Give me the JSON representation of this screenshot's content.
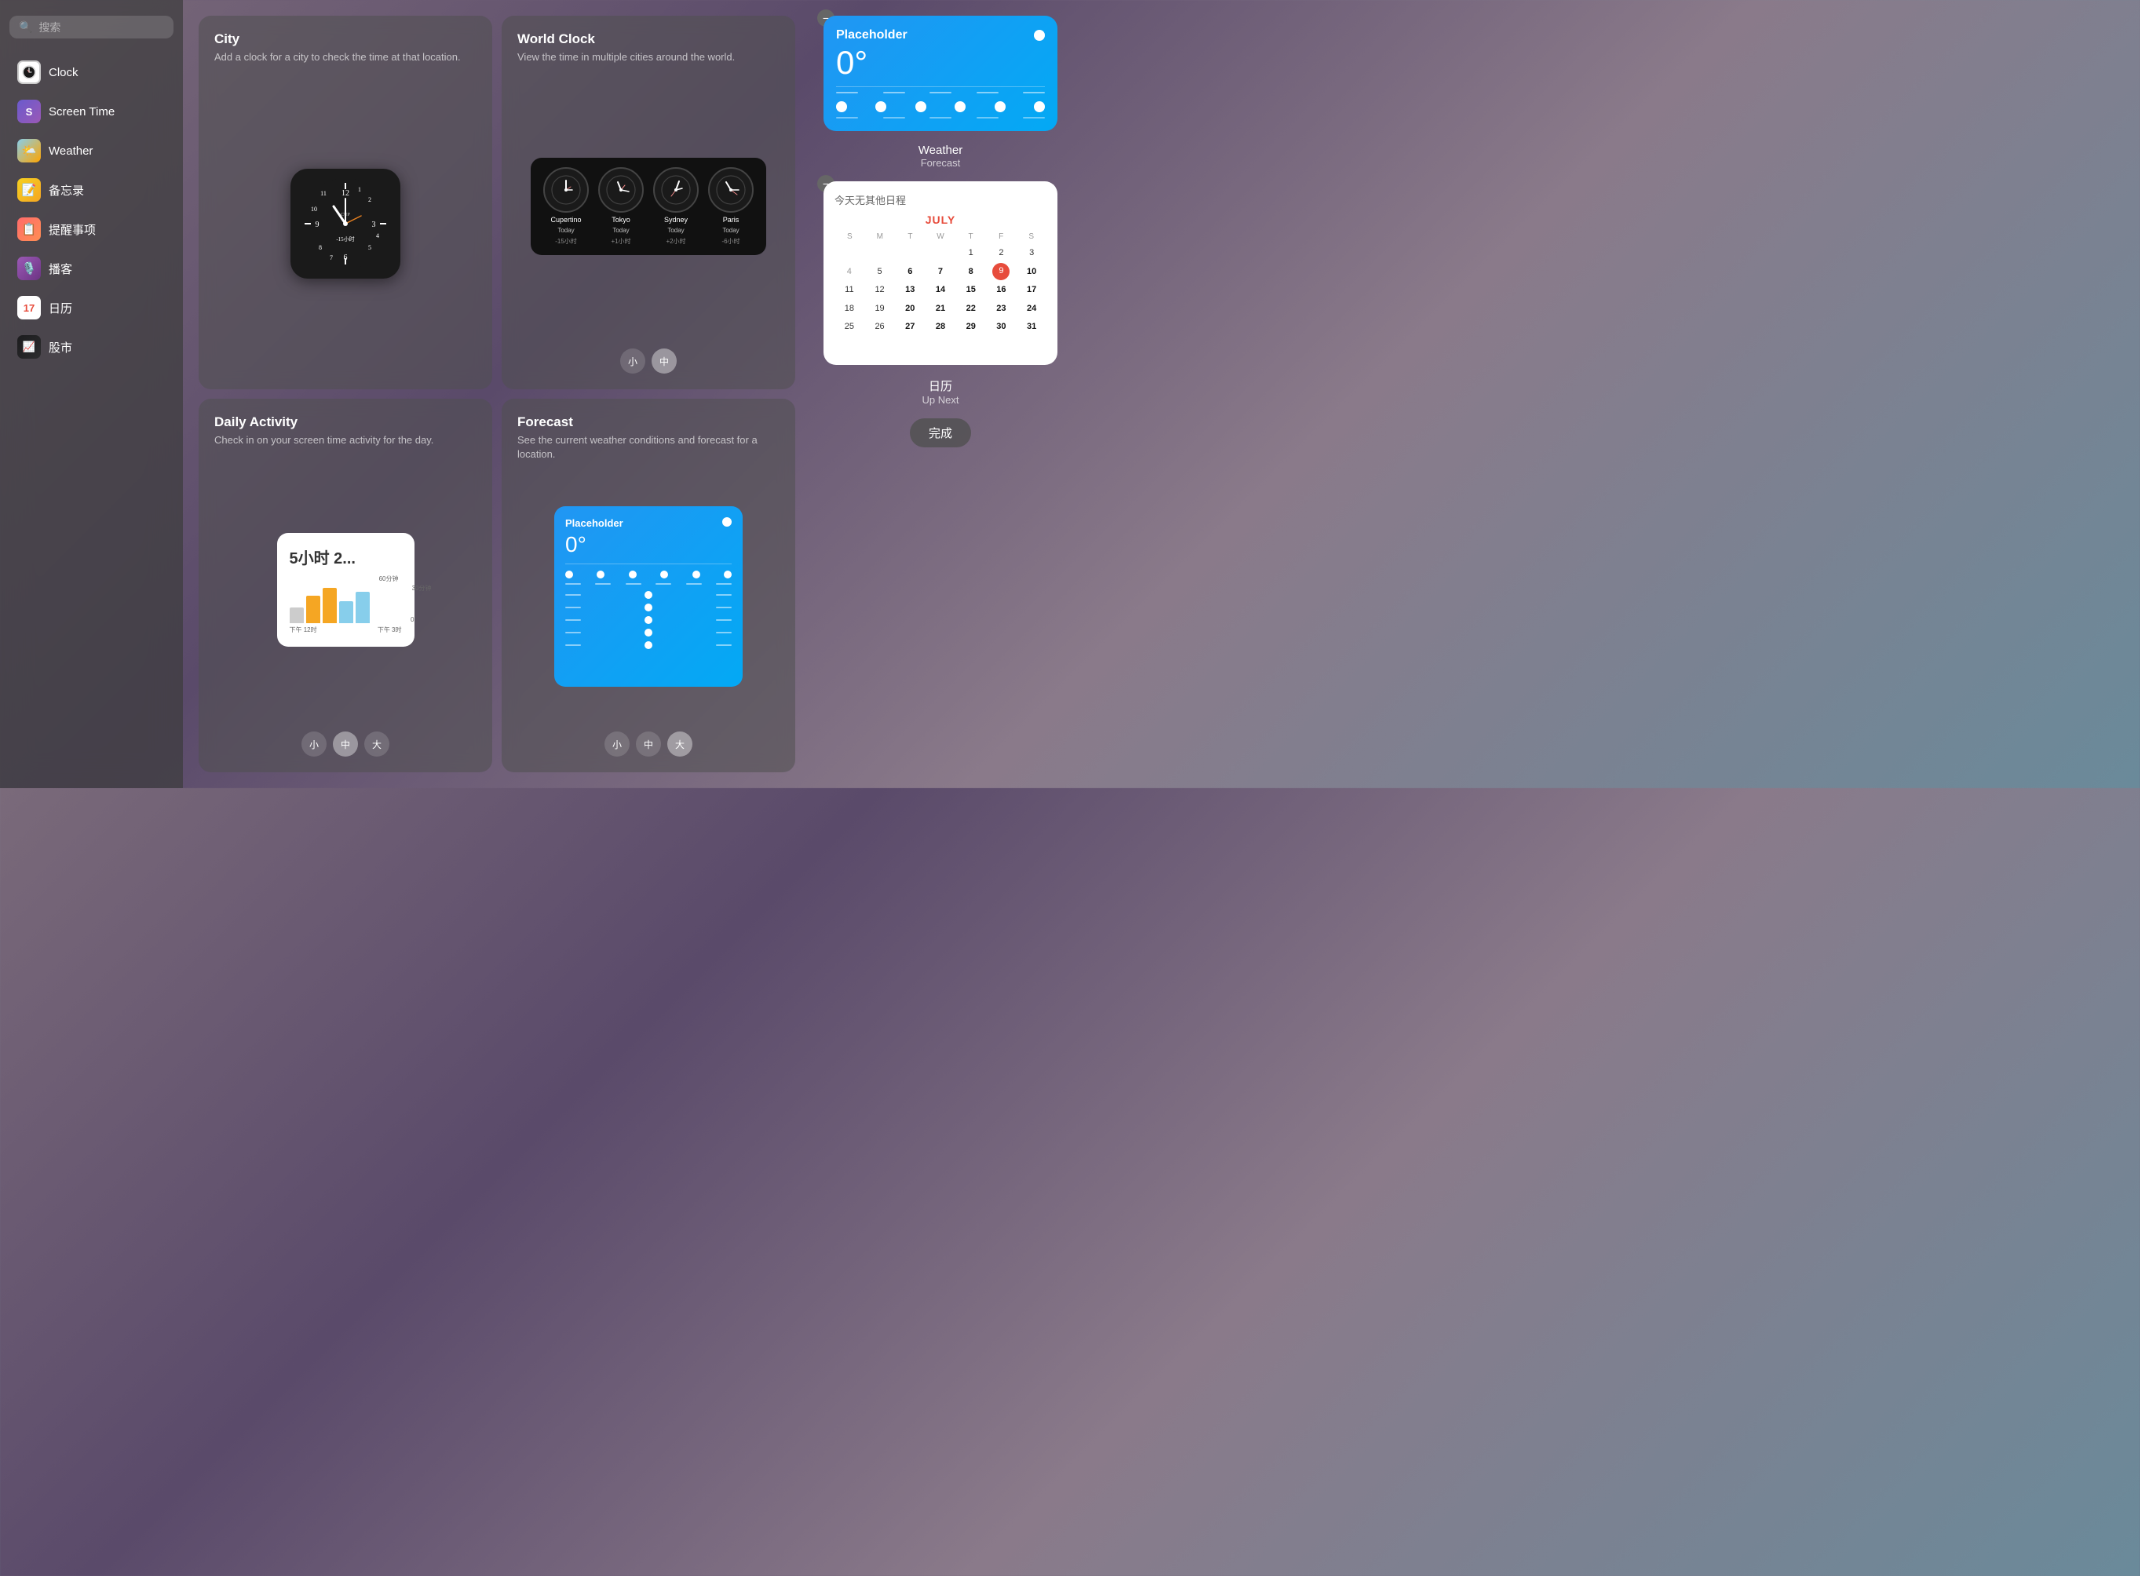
{
  "sidebar": {
    "search_placeholder": "搜索",
    "items": [
      {
        "id": "clock",
        "label": "Clock",
        "icon": "🕐",
        "icon_type": "clock"
      },
      {
        "id": "screentime",
        "label": "Screen Time",
        "icon": "S",
        "icon_type": "screentime"
      },
      {
        "id": "weather",
        "label": "Weather",
        "icon": "☁️",
        "icon_type": "weather"
      },
      {
        "id": "notes",
        "label": "备忘录",
        "icon": "📝",
        "icon_type": "notes"
      },
      {
        "id": "reminders",
        "label": "提醒事项",
        "icon": "📋",
        "icon_type": "reminders"
      },
      {
        "id": "podcasts",
        "label": "播客",
        "icon": "🎙️",
        "icon_type": "podcasts"
      },
      {
        "id": "calendar",
        "label": "日历",
        "icon": "📅",
        "icon_type": "calendar"
      },
      {
        "id": "stocks",
        "label": "股市",
        "icon": "📈",
        "icon_type": "stocks"
      }
    ]
  },
  "widgets": {
    "city": {
      "title": "City",
      "desc": "Add a clock for a city to check the time at that location."
    },
    "world_clock": {
      "title": "World Clock",
      "desc": "View the time in multiple cities around the world.",
      "cities": [
        {
          "name": "Cupertino",
          "time": "Today",
          "offset": "-15小时"
        },
        {
          "name": "Tokyo",
          "time": "Today",
          "offset": "+1小时"
        },
        {
          "name": "Sydney",
          "time": "Today",
          "offset": "+2小时"
        },
        {
          "name": "Paris",
          "time": "Today",
          "offset": "-6小时"
        }
      ],
      "size_options": [
        "小",
        "中"
      ]
    },
    "daily_activity": {
      "title": "Daily Activity",
      "desc": "Check in on your screen time activity for the day.",
      "preview_hours": "5小时 2...",
      "size_options": [
        "小",
        "中",
        "大"
      ]
    },
    "forecast": {
      "title": "Forecast",
      "desc": "See the current weather conditions and forecast for a location.",
      "placeholder_label": "Placeholder",
      "temp": "0°",
      "size_options": [
        "小",
        "中",
        "大"
      ]
    }
  },
  "right_panel": {
    "weather_widget": {
      "name": "Placeholder",
      "temp": "0°",
      "label": "Weather",
      "sublabel": "Forecast"
    },
    "calendar_widget": {
      "no_events": "今天无其他日程",
      "month": "JULY",
      "dow": [
        "S",
        "M",
        "T",
        "W",
        "T",
        "F",
        "S"
      ],
      "days": [
        [
          "",
          "",
          "",
          "",
          "1",
          "2",
          "3",
          "4"
        ],
        [
          "5",
          "6",
          "7",
          "8",
          "9",
          "10",
          "11"
        ],
        [
          "12",
          "13",
          "14",
          "15",
          "16",
          "17",
          "18"
        ],
        [
          "19",
          "20",
          "21",
          "22",
          "23",
          "24",
          "25"
        ],
        [
          "26",
          "27",
          "28",
          "29",
          "30",
          "31",
          ""
        ]
      ],
      "today": "9",
      "label": "日历",
      "sublabel": "Up Next"
    },
    "done_button": "完成"
  }
}
